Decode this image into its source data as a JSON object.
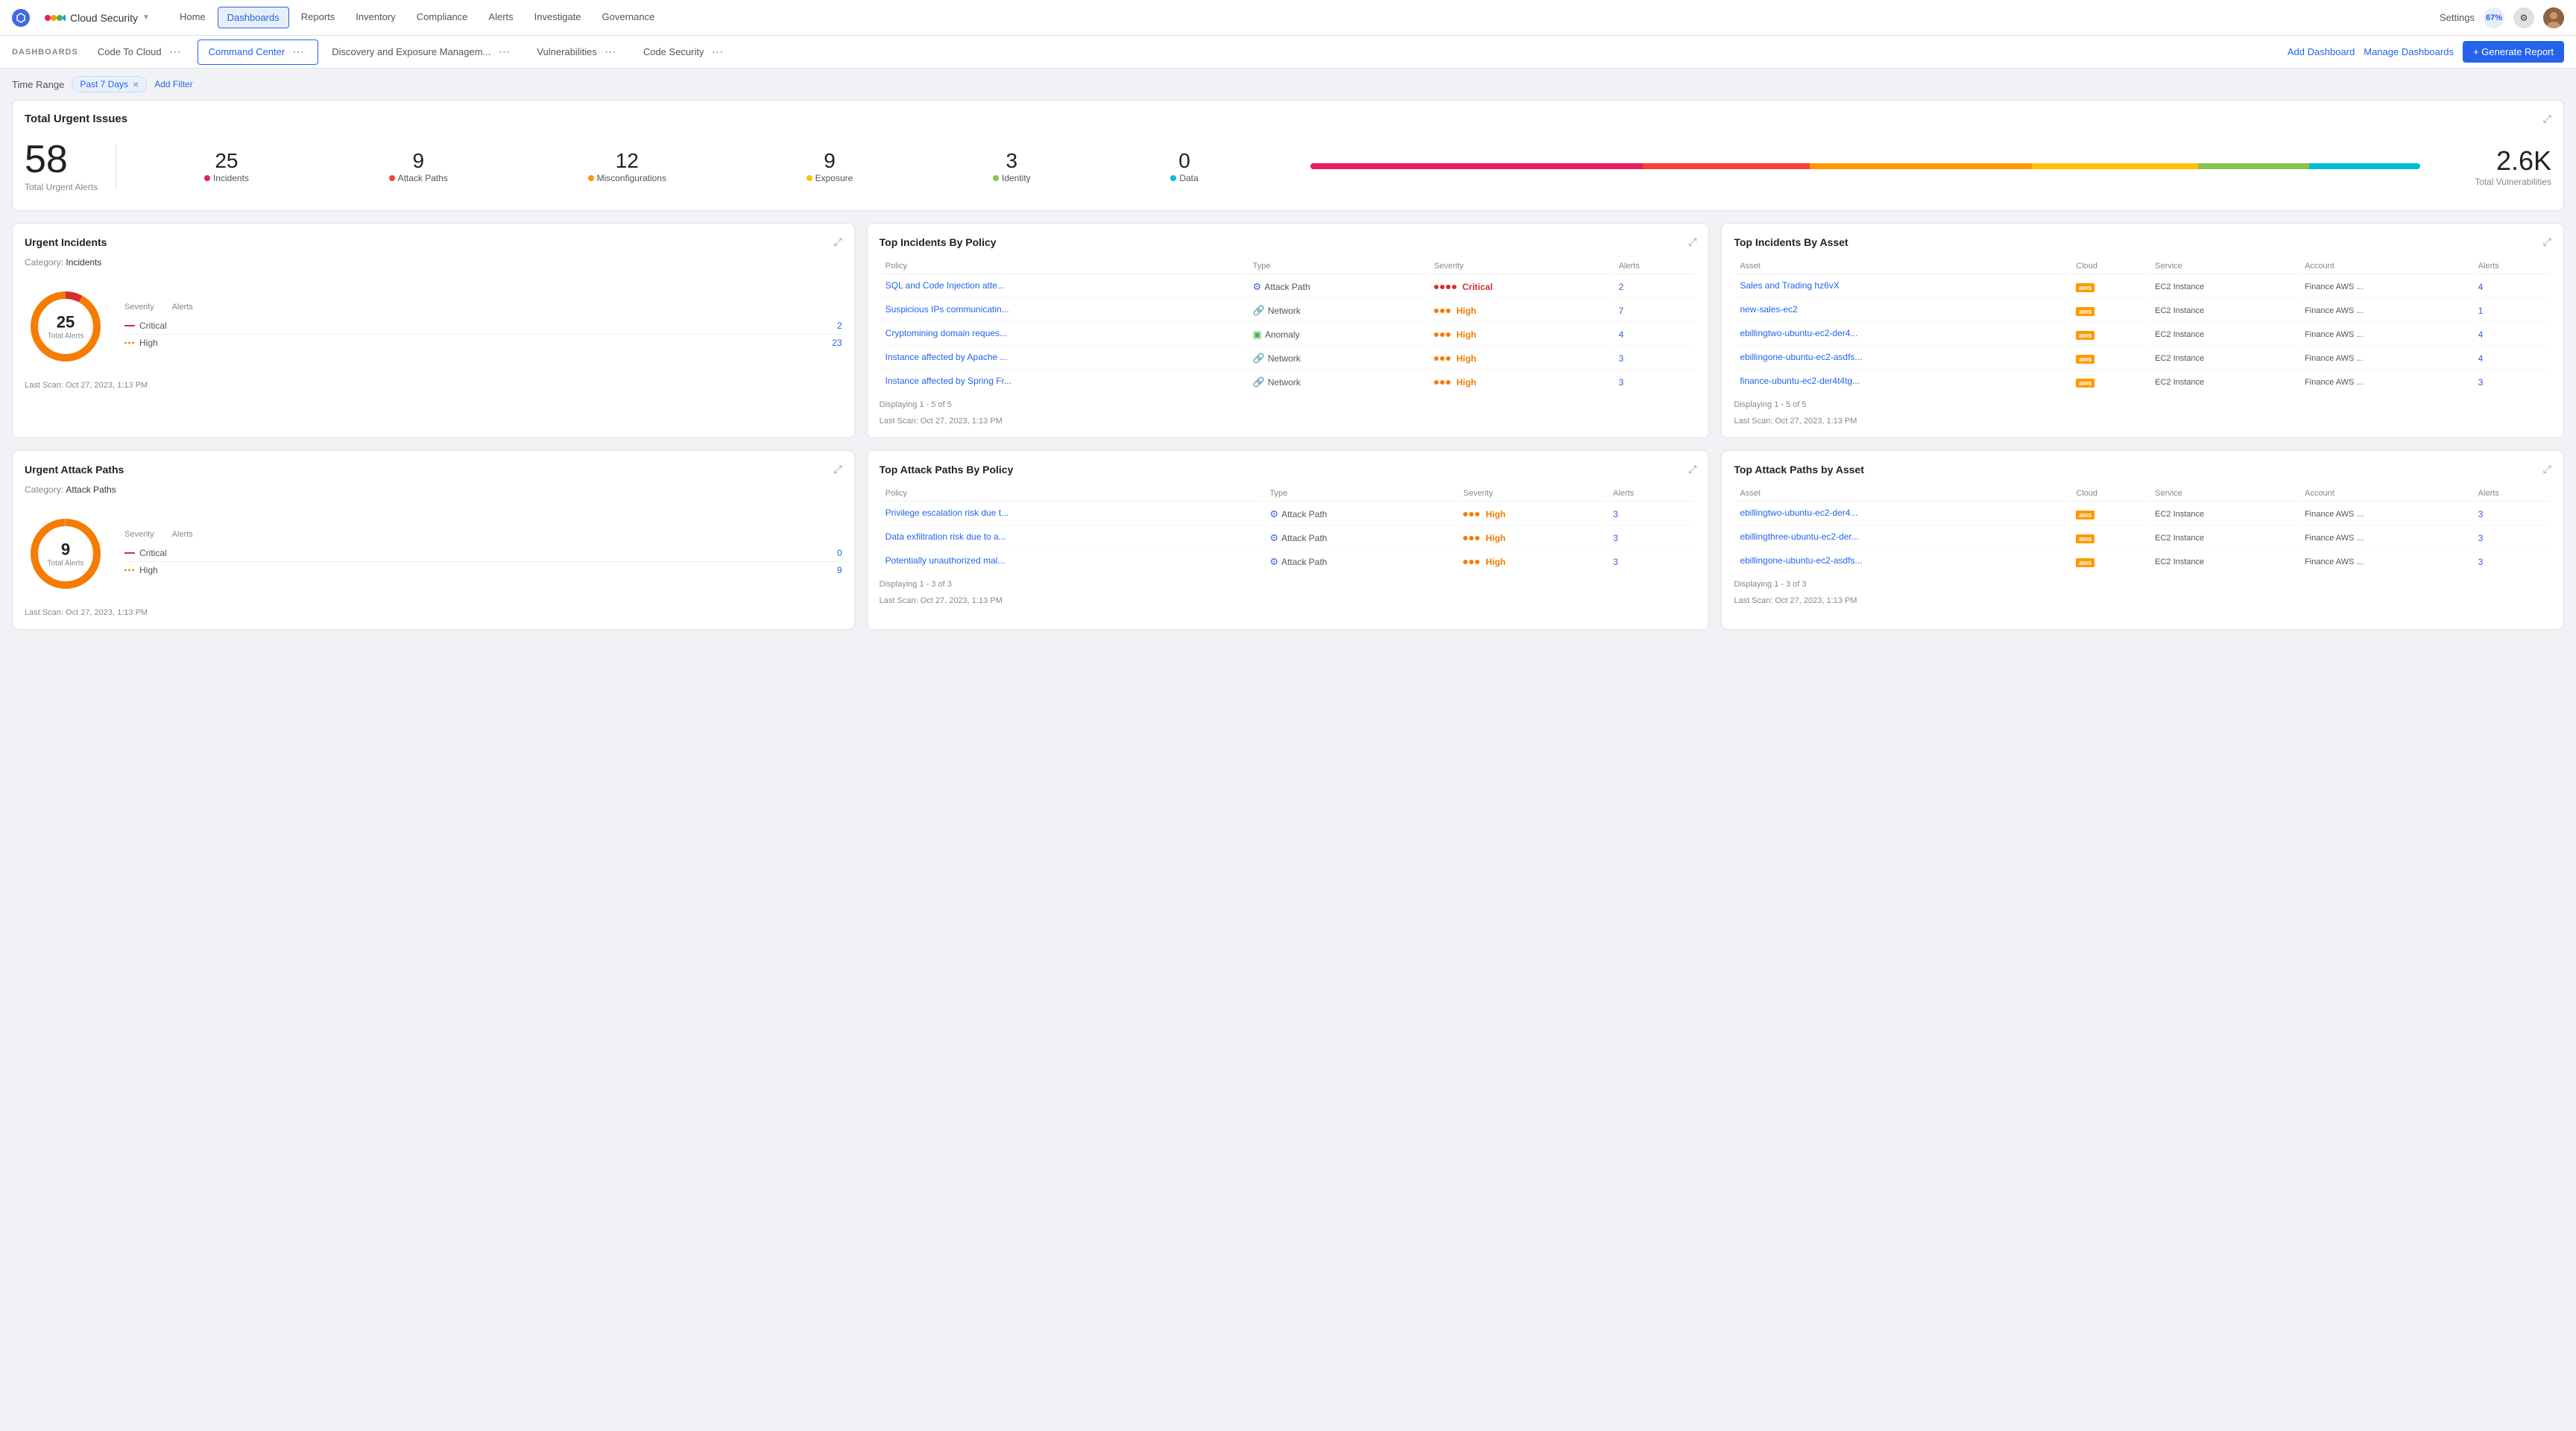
{
  "app": {
    "logo_color": "#4169e1",
    "brand_name": "Cloud Security",
    "brand_dots": [
      "#e91e63",
      "#ff9800",
      "#4caf50",
      "#2196f3"
    ]
  },
  "nav": {
    "items": [
      "Home",
      "Dashboards",
      "Reports",
      "Inventory",
      "Compliance",
      "Alerts",
      "Investigate",
      "Governance"
    ],
    "active": "Dashboards",
    "settings_label": "Settings"
  },
  "dashboard_bar": {
    "label": "DASHBOARDS",
    "tabs": [
      "Code To Cloud",
      "Command Center",
      "Discovery and Exposure Managem...",
      "Vulnerabilities",
      "Code Security"
    ],
    "active_tab": "Command Center",
    "add_dashboard": "Add Dashboard",
    "manage_dashboards": "Manage Dashboards",
    "generate_report": "+ Generate Report"
  },
  "filter_bar": {
    "time_range_label": "Time Range",
    "filter_value": "Past 7 Days",
    "add_filter": "Add Filter"
  },
  "total_urgent": {
    "title": "Total Urgent Issues",
    "total_alerts": 58,
    "total_alerts_label": "Total Urgent Alerts",
    "metrics": [
      {
        "num": 25,
        "label": "Incidents",
        "color": "#e91e63"
      },
      {
        "num": 9,
        "label": "Attack Paths",
        "color": "#f44336"
      },
      {
        "num": 12,
        "label": "Misconfigurations",
        "color": "#ff9800"
      },
      {
        "num": 9,
        "label": "Exposure",
        "color": "#ffc107"
      },
      {
        "num": 3,
        "label": "Identity",
        "color": "#8bc34a"
      },
      {
        "num": 0,
        "label": "Data",
        "color": "#00bcd4"
      }
    ],
    "progress_segments": [
      {
        "color": "#e91e63",
        "width": "30%"
      },
      {
        "color": "#f44336",
        "width": "15%"
      },
      {
        "color": "#ff9800",
        "width": "20%"
      },
      {
        "color": "#ffc107",
        "width": "15%"
      },
      {
        "color": "#8bc34a",
        "width": "10%"
      },
      {
        "color": "#00bcd4",
        "width": "10%"
      }
    ],
    "total_vulns": "2.6K",
    "total_vulns_label": "Total Vulnerabilities"
  },
  "urgent_incidents": {
    "title": "Urgent Incidents",
    "category_label": "Incidents",
    "total_alerts": 25,
    "donut_sub": "Total Alerts",
    "severity_rows": [
      {
        "level": "Critical",
        "style": "critical",
        "count": 2
      },
      {
        "level": "High",
        "style": "high",
        "count": 23
      }
    ],
    "scan_info": "Last Scan: Oct 27, 2023, 1:13 PM"
  },
  "top_incidents_policy": {
    "title": "Top Incidents By Policy",
    "columns": [
      "Policy",
      "Type",
      "Severity",
      "Alerts"
    ],
    "rows": [
      {
        "policy": "SQL and Code Injection atte...",
        "type": "Attack Path",
        "type_icon": "⚙",
        "severity": "Critical",
        "alerts": 2
      },
      {
        "policy": "Suspicious IPs communicatin...",
        "type": "Network",
        "type_icon": "🔗",
        "severity": "High",
        "alerts": 7
      },
      {
        "policy": "Cryptomining domain reques...",
        "type": "Anomaly",
        "type_icon": "🟩",
        "severity": "High",
        "alerts": 4
      },
      {
        "policy": "Instance affected by Apache ...",
        "type": "Network",
        "type_icon": "🔗",
        "severity": "High",
        "alerts": 3
      },
      {
        "policy": "Instance affected by Spring Fr...",
        "type": "Network",
        "type_icon": "🔗",
        "severity": "High",
        "alerts": 3
      }
    ],
    "display_info": "Displaying 1 - 5 of 5",
    "scan_info": "Last Scan: Oct 27, 2023, 1:13 PM"
  },
  "top_incidents_asset": {
    "title": "Top Incidents By Asset",
    "columns": [
      "Asset",
      "Cloud",
      "Service",
      "Account",
      "Alerts"
    ],
    "rows": [
      {
        "asset": "Sales and Trading hz6vX",
        "service": "EC2 Instance",
        "account": "Finance AWS ...",
        "alerts": 4
      },
      {
        "asset": "new-sales-ec2",
        "service": "EC2 Instance",
        "account": "Finance AWS ...",
        "alerts": 1
      },
      {
        "asset": "ebillingtwo-ubuntu-ec2-der4...",
        "service": "EC2 Instance",
        "account": "Finance AWS ...",
        "alerts": 4
      },
      {
        "asset": "ebillingone-ubuntu-ec2-asdfs...",
        "service": "EC2 Instance",
        "account": "Finance AWS ...",
        "alerts": 4
      },
      {
        "asset": "finance-ubuntu-ec2-der4t4tg...",
        "service": "EC2 Instance",
        "account": "Finance AWS ...",
        "alerts": 3
      }
    ],
    "display_info": "Displaying 1 - 5 of 5",
    "scan_info": "Last Scan: Oct 27, 2023, 1:13 PM"
  },
  "urgent_attack_paths": {
    "title": "Urgent Attack Paths",
    "category_label": "Attack Paths",
    "total_alerts": 9,
    "donut_sub": "Total Alerts",
    "severity_rows": [
      {
        "level": "Critical",
        "style": "critical",
        "count": 0
      },
      {
        "level": "High",
        "style": "high",
        "count": 9
      }
    ],
    "scan_info": "Last Scan: Oct 27, 2023, 1:13 PM"
  },
  "top_attack_paths_policy": {
    "title": "Top Attack Paths By Policy",
    "columns": [
      "Policy",
      "Type",
      "Severity",
      "Alerts"
    ],
    "rows": [
      {
        "policy": "Privilege escalation risk due t...",
        "type": "Attack Path",
        "type_icon": "⚙",
        "severity": "High",
        "alerts": 3
      },
      {
        "policy": "Data exfiltration risk due to a...",
        "type": "Attack Path",
        "type_icon": "⚙",
        "severity": "High",
        "alerts": 3
      },
      {
        "policy": "Potentially unauthorized mal...",
        "type": "Attack Path",
        "type_icon": "⚙",
        "severity": "High",
        "alerts": 3
      }
    ],
    "display_info": "Displaying 1 - 3 of 3",
    "scan_info": "Last Scan: Oct 27, 2023, 1:13 PM"
  },
  "top_attack_paths_asset": {
    "title": "Top Attack Paths by Asset",
    "columns": [
      "Asset",
      "Cloud",
      "Service",
      "Account",
      "Alerts"
    ],
    "rows": [
      {
        "asset": "ebillingtwo-ubuntu-ec2-der4...",
        "service": "EC2 Instance",
        "account": "Finance AWS ...",
        "alerts": 3
      },
      {
        "asset": "ebillingthree-ubuntu-ec2-der...",
        "service": "EC2 Instance",
        "account": "Finance AWS ...",
        "alerts": 3
      },
      {
        "asset": "ebillingone-ubuntu-ec2-asdfs...",
        "service": "EC2 Instance",
        "account": "Finance AWS ...",
        "alerts": 3
      }
    ],
    "display_info": "Displaying 1 - 3 of 3",
    "scan_info": "Last Scan: Oct 27, 2023, 1:13 PM"
  }
}
